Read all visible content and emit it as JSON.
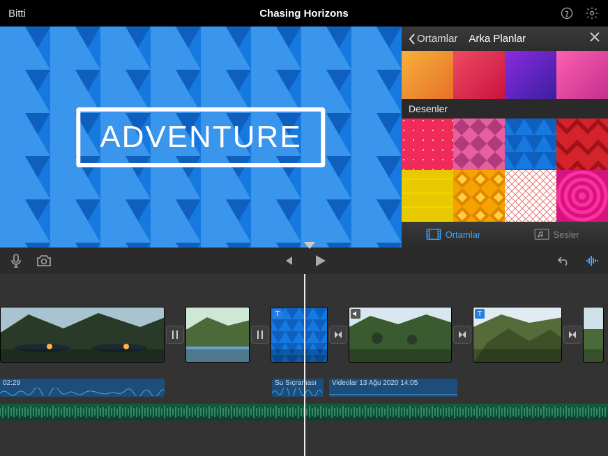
{
  "header": {
    "done_label": "Bitti",
    "project_title": "Chasing Horizons"
  },
  "preview": {
    "title_text": "ADVENTURE"
  },
  "sidepanel": {
    "back_label": "Ortamlar",
    "title": "Arka Planlar",
    "section_patterns": "Desenler",
    "gradients": [
      "orange",
      "red",
      "purple",
      "pink"
    ],
    "patterns": [
      "red-dots",
      "pink-diamond",
      "blue-triangle",
      "red-chevron",
      "yellow-grid",
      "orange-diamond",
      "white-scribble",
      "magenta-rings"
    ],
    "tabs": {
      "media": "Ortamlar",
      "audio": "Sesler",
      "active": "media"
    }
  },
  "timeline": {
    "clips": [
      {
        "id": "clip1",
        "type": "video",
        "audio_time": "02:29"
      },
      {
        "id": "clip2",
        "type": "video"
      },
      {
        "id": "clip3",
        "type": "background",
        "has_title": true
      },
      {
        "id": "clip4",
        "type": "video",
        "has_audio_icon": true
      },
      {
        "id": "clip5",
        "type": "video",
        "has_title": true
      },
      {
        "id": "clip6",
        "type": "video"
      }
    ],
    "audio_clips": [
      {
        "label": "02:29"
      },
      {
        "label": "Su Sıçraması"
      },
      {
        "label": "Videolar 13 Ağu 2020 14:05"
      }
    ]
  }
}
